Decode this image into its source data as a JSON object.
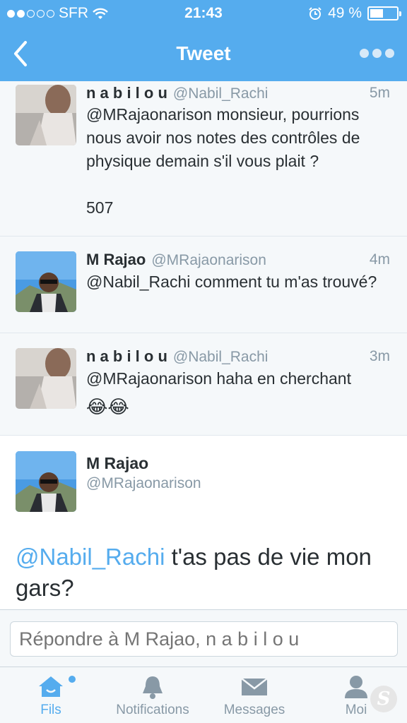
{
  "status_bar": {
    "carrier": "SFR",
    "time": "21:43",
    "battery": "49 %",
    "battery_level": 0.49
  },
  "nav": {
    "title": "Tweet"
  },
  "tweets": [
    {
      "name": "n a b i l o u",
      "handle": "@Nabil_Rachi",
      "time": "5m",
      "text": "@MRajaonarison monsieur, pourrions nous avoir nos notes des contrôles de physique demain s'il vous plait ?\n\n507"
    },
    {
      "name": "M Rajao",
      "handle": "@MRajaonarison",
      "time": "4m",
      "text": "@Nabil_Rachi comment tu m'as trouvé?"
    },
    {
      "name": "n a b i l o u",
      "handle": "@Nabil_Rachi",
      "time": "3m",
      "text": "@MRajaonarison haha en cherchant",
      "emoji": "😂😂"
    }
  ],
  "detail": {
    "name": "M Rajao",
    "handle": "@MRajaonarison",
    "mention": "@Nabil_Rachi",
    "text": " t'as pas de vie mon gars?"
  },
  "reply": {
    "placeholder": "Répondre à M Rajao, n a b i l o u"
  },
  "tabs": [
    {
      "label": "Fils",
      "icon": "home-icon"
    },
    {
      "label": "Notifications",
      "icon": "bell-icon"
    },
    {
      "label": "Messages",
      "icon": "envelope-icon"
    },
    {
      "label": "Moi",
      "icon": "person-icon"
    }
  ],
  "colors": {
    "brand": "#55acee",
    "text": "#292f33",
    "muted": "#8899a6"
  }
}
